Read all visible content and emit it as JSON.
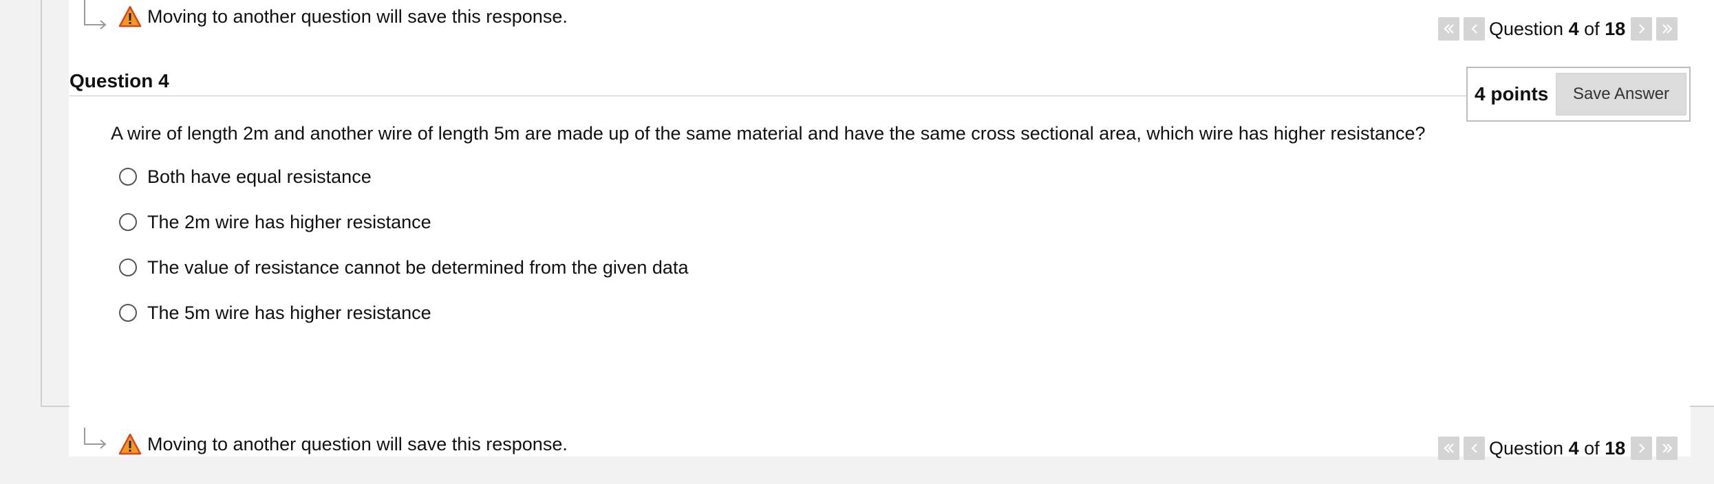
{
  "notice_top": {
    "text": "Moving to another question will save this response."
  },
  "notice_bottom": {
    "text": "Moving to another question will save this response."
  },
  "pager_top": {
    "prefix": "Question",
    "current": "4",
    "of": "of",
    "total": "18"
  },
  "pager_bottom": {
    "prefix": "Question",
    "current": "4",
    "of": "of",
    "total": "18"
  },
  "question": {
    "title": "Question 4",
    "points": "4 points",
    "save_label": "Save Answer",
    "text": "A wire of length 2m and another wire of length 5m are made up of the same material and have the same cross sectional area, which wire has higher resistance?",
    "options": [
      {
        "label": "Both have equal resistance",
        "selected": false
      },
      {
        "label": "The 2m wire has higher resistance",
        "selected": false
      },
      {
        "label": "The value of resistance cannot be determined from the given data",
        "selected": false
      },
      {
        "label": "The 5m wire has higher resistance",
        "selected": false
      }
    ]
  },
  "icons": {
    "notice": "elbow-arrow-icon",
    "warning": "warning-icon",
    "pager": [
      "double-chevron-left-icon",
      "chevron-left-icon",
      "chevron-right-icon",
      "double-chevron-right-icon"
    ]
  },
  "colors": {
    "warning_fill": "#f39a1e",
    "warning_stroke": "#d9441c",
    "pager_button": "#d4d4d4",
    "save_button": "#dcdcdc"
  }
}
